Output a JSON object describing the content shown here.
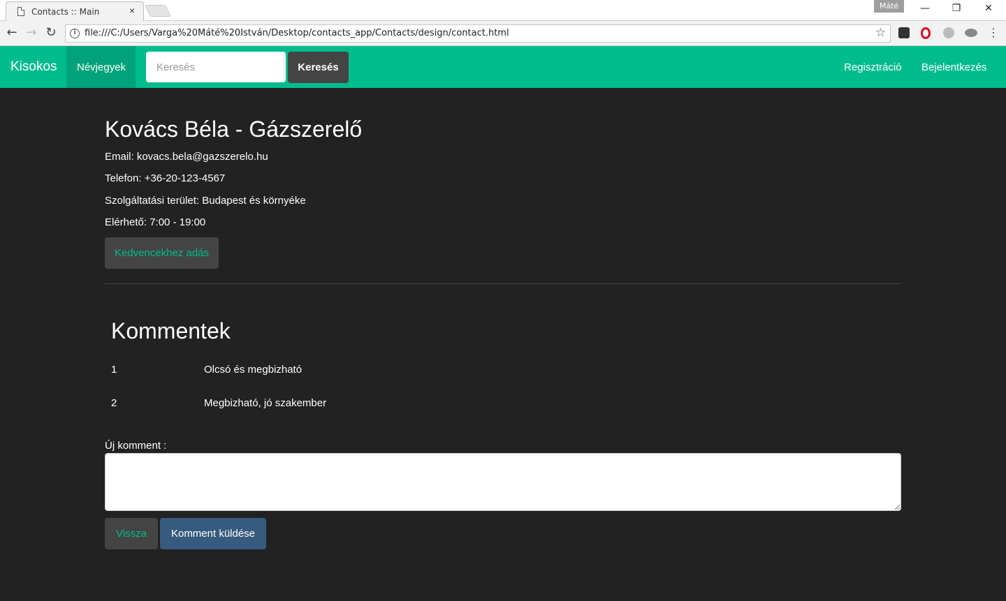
{
  "browser": {
    "tab_title": "Contacts :: Main",
    "tab_close": "×",
    "profile_name": "Máté",
    "url": "file:///C:/Users/Varga%20Máté%20István/Desktop/contacts_app/Contacts/design/contact.html",
    "window_controls": {
      "minimize": "—",
      "restore": "❐",
      "close": "✕"
    },
    "nav": {
      "back": "←",
      "forward": "→",
      "reload": "↻"
    },
    "bookmark_icon": "☆"
  },
  "navbar": {
    "brand": "Kisokos",
    "active_item": "Névjegyek",
    "search_placeholder": "Keresés",
    "search_button": "Keresés",
    "register": "Regisztráció",
    "login": "Bejelentkezés",
    "colors": {
      "primary": "#00bc8c",
      "active": "#00a379"
    }
  },
  "contact": {
    "title": "Kovács Béla - Gázszerelő",
    "email": "Email: kovacs.bela@gazszerelo.hu",
    "phone": "Telefon: +36-20-123-4567",
    "area": "Szolgáltatási terület: Budapest és környéke",
    "hours": "Elérhető: 7:00 - 19:00",
    "favorite_button": "Kedvencekhez adás"
  },
  "comments": {
    "title": "Kommentek",
    "items": [
      {
        "num": "1",
        "text": "Olcsó és megbizható"
      },
      {
        "num": "2",
        "text": "Megbizható, jó szakember"
      }
    ],
    "new_label": "Új komment :",
    "textarea_value": "",
    "back_button": "Vissza",
    "send_button": "Komment küldése"
  }
}
